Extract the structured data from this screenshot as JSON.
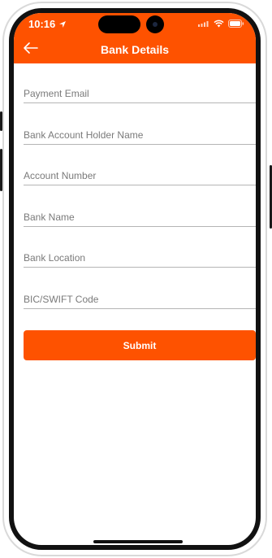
{
  "status_bar": {
    "time": "10:16"
  },
  "header": {
    "title": "Bank Details"
  },
  "form": {
    "fields": [
      {
        "placeholder": "Payment Email",
        "value": ""
      },
      {
        "placeholder": "Bank Account Holder Name",
        "value": ""
      },
      {
        "placeholder": "Account Number",
        "value": ""
      },
      {
        "placeholder": "Bank Name",
        "value": ""
      },
      {
        "placeholder": "Bank Location",
        "value": ""
      },
      {
        "placeholder": "BIC/SWIFT Code",
        "value": ""
      }
    ],
    "submit_label": "Submit"
  },
  "icons": {
    "back": "arrow-left-icon",
    "location": "location-arrow-icon",
    "wifi": "wifi-icon",
    "battery": "battery-icon",
    "signal": "signal-icon"
  },
  "colors": {
    "accent": "#fe5200",
    "background": "#ffffff",
    "underline": "#b5b5b5"
  }
}
